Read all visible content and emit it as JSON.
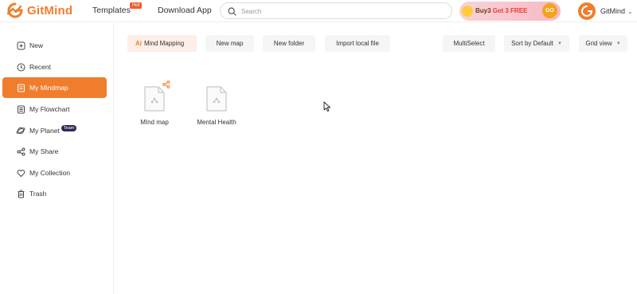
{
  "header": {
    "logo_text": "GitMind",
    "nav": {
      "templates": "Templates",
      "hot": "Hot",
      "download": "Download App"
    },
    "search_placeholder": "Search",
    "promo": {
      "buy": "Buy3",
      "free": "Get 3 FREE",
      "go": "GO"
    },
    "user_name": "GitMind"
  },
  "sidebar": {
    "items": [
      {
        "label": "New",
        "icon": "new-icon"
      },
      {
        "label": "Recent",
        "icon": "clock-icon"
      },
      {
        "label": "My Mindmap",
        "icon": "document-icon",
        "active": true
      },
      {
        "label": "My Flowchart",
        "icon": "flowchart-icon"
      },
      {
        "label": "My Planet",
        "icon": "planet-icon",
        "badge": "Team"
      },
      {
        "label": "My Share",
        "icon": "share-icon"
      },
      {
        "label": "My Collection",
        "icon": "heart-icon"
      },
      {
        "label": "Trash",
        "icon": "trash-icon"
      }
    ]
  },
  "toolbar": {
    "ai_tag": "Ai",
    "ai_label": "Mind Mapping",
    "new_map": "New map",
    "new_folder": "New folder",
    "import": "Import local file",
    "multiselect": "MultiSelect",
    "sort": "Sort by Default",
    "view": "Grid view"
  },
  "files": [
    {
      "name": "MInd map",
      "shared": true
    },
    {
      "name": "Mental Health",
      "shared": false
    }
  ],
  "colors": {
    "accent": "#f07d2c",
    "badge": "#2e2a56",
    "hot": "#f15b2a"
  }
}
